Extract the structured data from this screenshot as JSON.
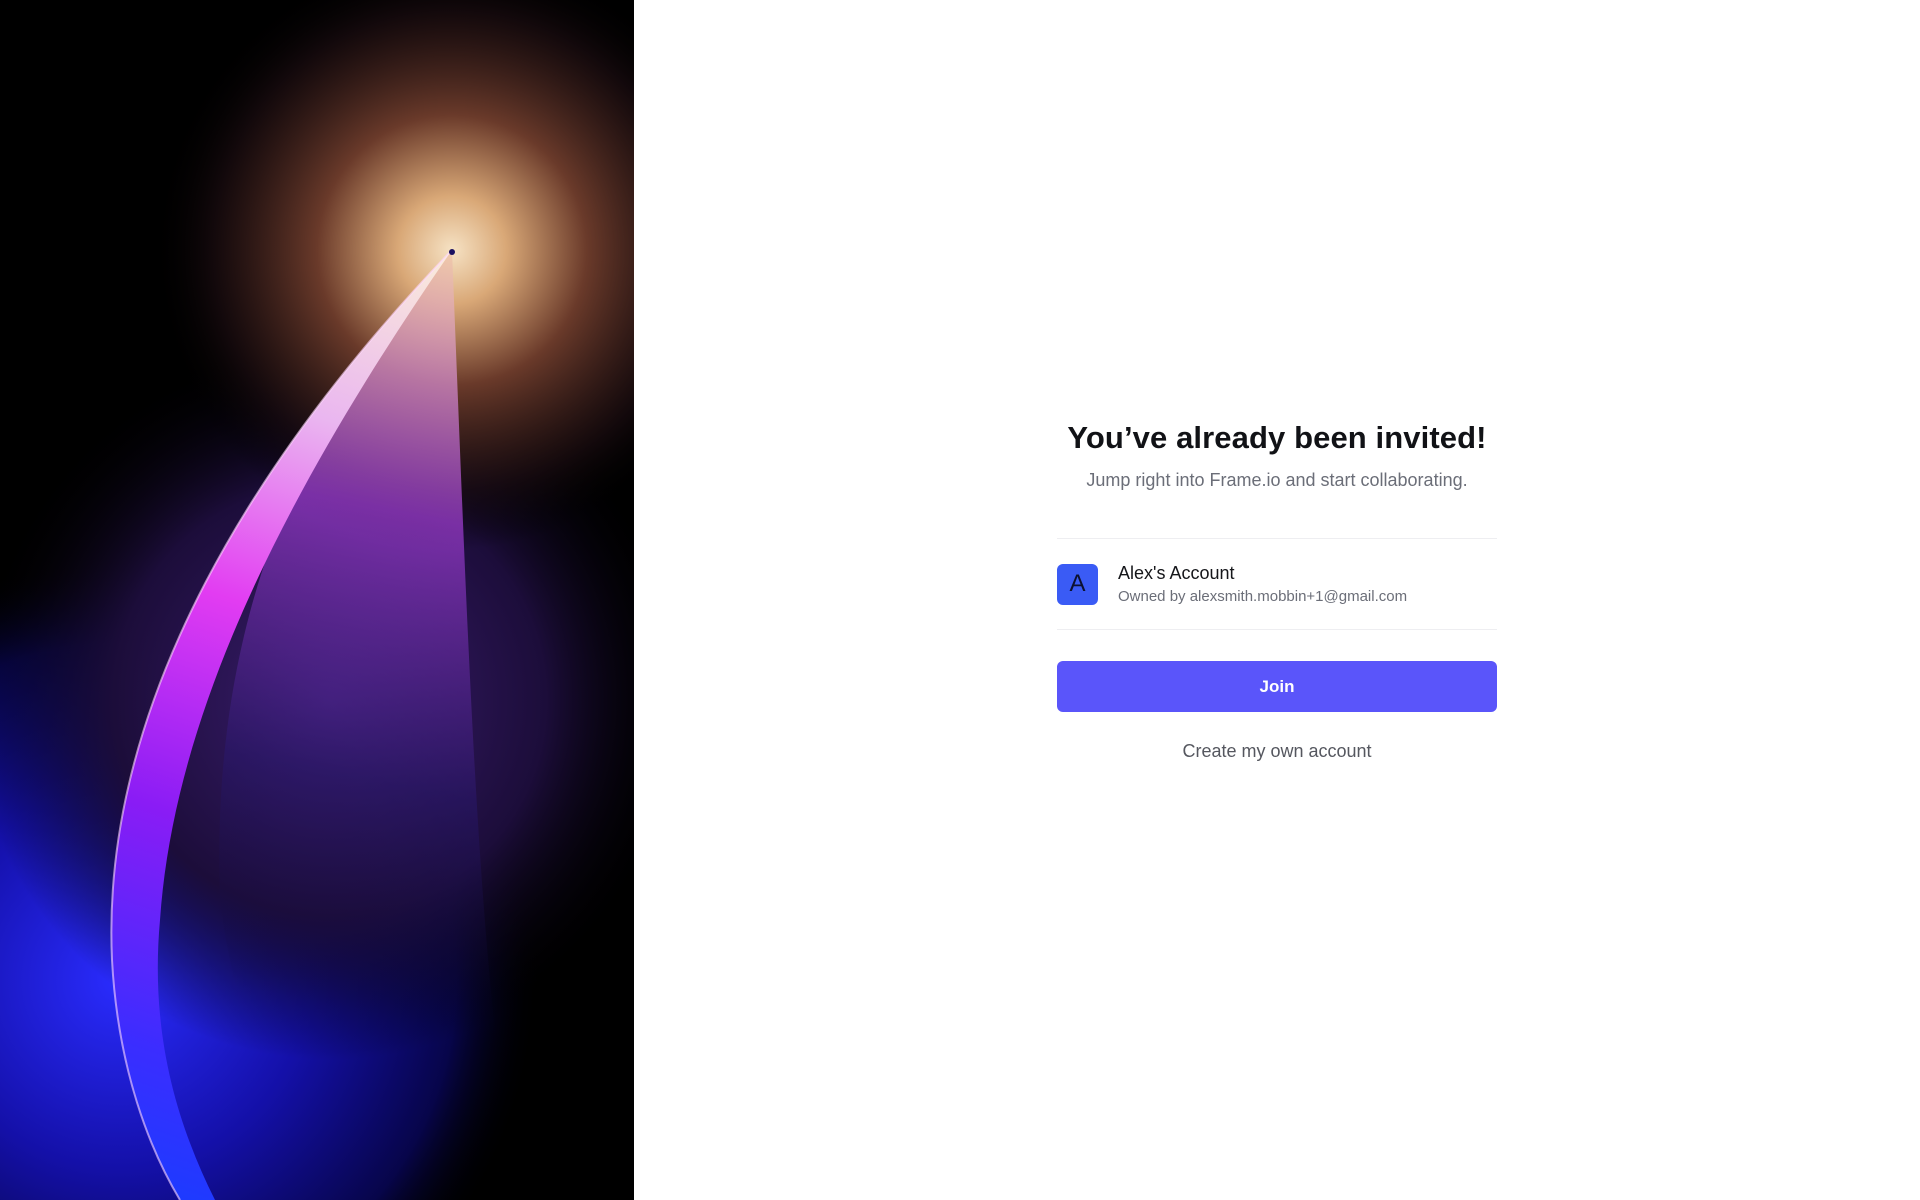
{
  "invite": {
    "title": "You’ve already been invited!",
    "subtitle": "Jump right into Frame.io and start collaborating."
  },
  "account": {
    "avatar_letter": "A",
    "name": "Alex's Account",
    "owner": "Owned by alexsmith.mobbin+1@gmail.com"
  },
  "actions": {
    "join_label": "Join",
    "create_label": "Create my own account"
  },
  "colors": {
    "primary": "#5a55fa",
    "avatar_bg": "#3a5bf5",
    "title": "#111216",
    "muted": "#6b6e78",
    "divider": "#eeeef1"
  },
  "art": {
    "description_icon": "abstract-light-arc-art"
  }
}
